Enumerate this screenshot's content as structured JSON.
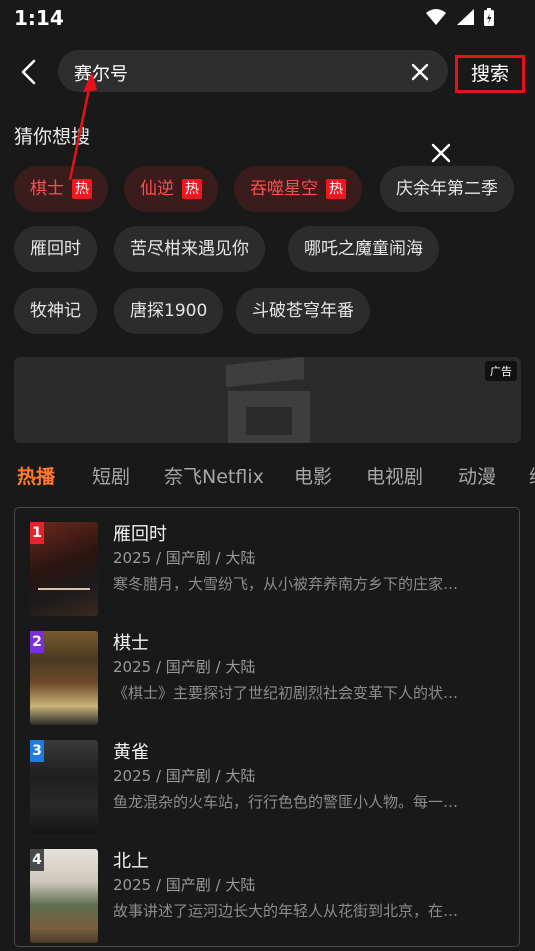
{
  "status": {
    "time": "1:14"
  },
  "search": {
    "query": "赛尔号",
    "button_label": "搜索"
  },
  "suggest": {
    "title": "猜你想搜",
    "hot_badge": "热",
    "chips": [
      {
        "label": "棋士",
        "hot": true
      },
      {
        "label": "仙逆",
        "hot": true
      },
      {
        "label": "吞噬星空",
        "hot": true
      },
      {
        "label": "庆余年第二季",
        "hot": false
      },
      {
        "label": "雁回时",
        "hot": false
      },
      {
        "label": "苦尽柑来遇见你",
        "hot": false
      },
      {
        "label": "哪吒之魔童闹海",
        "hot": false
      },
      {
        "label": "牧神记",
        "hot": false
      },
      {
        "label": "唐探1900",
        "hot": false
      },
      {
        "label": "斗破苍穹年番",
        "hot": false
      }
    ]
  },
  "ad": {
    "badge": "广告"
  },
  "tabs": [
    "热播",
    "短剧",
    "奈飞Netflix",
    "电影",
    "电视剧",
    "动漫",
    "综"
  ],
  "ranking": [
    {
      "rank": "1",
      "title": "雁回时",
      "meta": "2025 / 国产剧 / 大陆",
      "desc": "寒冬腊月，大雪纷飞，从小被弃养南方乡下的庄家…",
      "rank_color": "#e8212b"
    },
    {
      "rank": "2",
      "title": "棋士",
      "meta": "2025 / 国产剧 / 大陆",
      "desc": "《棋士》主要探讨了世纪初剧烈社会变革下人的状…",
      "rank_color": "#7a2fd8"
    },
    {
      "rank": "3",
      "title": "黄雀",
      "meta": "2025 / 国产剧 / 大陆",
      "desc": "鱼龙混杂的火车站，行行色色的警匪小人物。每一…",
      "rank_color": "#1f7be0"
    },
    {
      "rank": "4",
      "title": "北上",
      "meta": "2025 / 国产剧 / 大陆",
      "desc": "故事讲述了运河边长大的年轻人从花街到北京，在…",
      "rank_color": "#4a4a4a"
    }
  ]
}
